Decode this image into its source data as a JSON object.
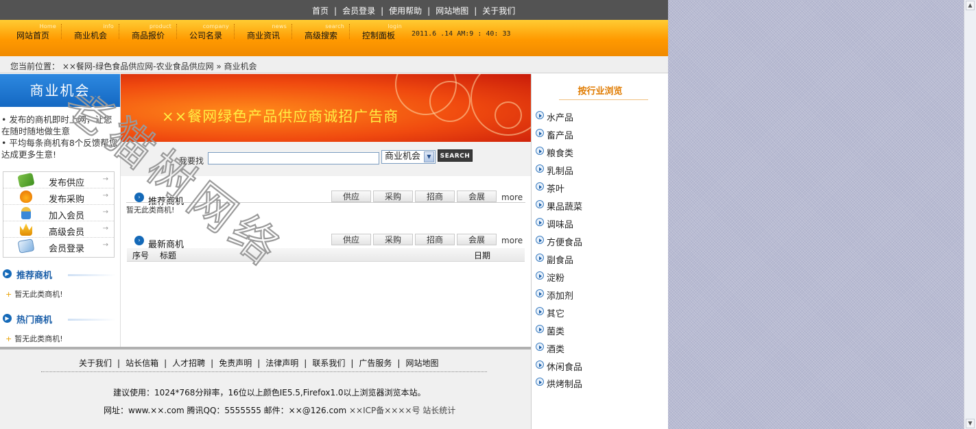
{
  "topbar": {
    "links": [
      "首页",
      "会员登录",
      "使用帮助",
      "网站地图",
      "关于我们"
    ],
    "separator": "|"
  },
  "nav": {
    "items": [
      {
        "cn": "网站首页",
        "en": "Home"
      },
      {
        "cn": "商业机会",
        "en": "info"
      },
      {
        "cn": "商品报价",
        "en": "product"
      },
      {
        "cn": "公司名录",
        "en": "company"
      },
      {
        "cn": "商业资讯",
        "en": "news"
      },
      {
        "cn": "高级搜索",
        "en": "search"
      },
      {
        "cn": "控制面板",
        "en": "login"
      }
    ],
    "clock": "2011.6 .14  AM:9  : 40: 33"
  },
  "breadcrumb": {
    "text": "您当前位置： ××餐网-绿色食品供应网-农业食品供应网 » 商业机会"
  },
  "left": {
    "header": "商业机会",
    "tips": [
      "• 发布的商机即时上网，让您在随时随地做生意",
      "• 平均每条商机有8个反馈帮您达成更多生意!"
    ],
    "menu": [
      {
        "label": "发布供应",
        "icon": "money-icon",
        "arrow": "→"
      },
      {
        "label": "发布采购",
        "icon": "bag-icon",
        "arrow": "→"
      },
      {
        "label": "加入会员",
        "icon": "person-icon",
        "arrow": "→"
      },
      {
        "label": "高级会员",
        "icon": "crown-icon",
        "arrow": "→"
      },
      {
        "label": "会员登录",
        "icon": "login-icon",
        "arrow": "→"
      }
    ],
    "recommended": {
      "title": "推荐商机",
      "empty": "暂无此类商机!"
    },
    "hot": {
      "title": "热门商机",
      "empty": "暂无此类商机!"
    },
    "bullet": "+"
  },
  "banner": {
    "text": "××餐网绿色产品供应商诚招广告商"
  },
  "search": {
    "label": "我要找",
    "value": "",
    "select": "商业机会",
    "button": "SEARCH",
    "dropdown_glyph": "▼"
  },
  "blocks": {
    "recommended": {
      "title": "推荐商机",
      "tabs": [
        "供应",
        "采购",
        "招商",
        "会展"
      ],
      "more": "more",
      "empty": "暂无此类商机!"
    },
    "latest": {
      "title": "最新商机",
      "tabs": [
        "供应",
        "采购",
        "招商",
        "会展"
      ],
      "more": "more",
      "columns": [
        "序号",
        "标题",
        "日期"
      ]
    }
  },
  "right": {
    "title": "按行业浏览",
    "items": [
      "水产品",
      "畜产品",
      "粮食类",
      "乳制品",
      "茶叶",
      "果品蔬菜",
      "调味品",
      "方便食品",
      "副食品",
      "淀粉",
      "添加剂",
      "其它",
      "菌类",
      "酒类",
      "休闲食品",
      "烘烤制品"
    ]
  },
  "footer": {
    "links": [
      "关于我们",
      "站长信箱",
      "人才招聘",
      "免责声明",
      "法律声明",
      "联系我们",
      "广告服务",
      "网站地图"
    ],
    "separator": "|",
    "recommend": "建议使用：1024*768分辩率，16位以上颜色IE5.5,Firefox1.0以上浏览器浏览本站。",
    "contact": "网址：www.××.com 腾讯QQ：5555555 邮件：××@126.com",
    "icp": "××ICP备××××号 站长统计"
  },
  "watermark": {
    "text": "老猫树网络"
  },
  "scrollbar": {
    "up": "▲",
    "down": "▼"
  },
  "colors": {
    "topbar": "#535353",
    "nav_orange": "#ff9900",
    "left_header_blue": "#1468c2",
    "right_title_orange": "#e07b00",
    "banner_red": "#f04a0f",
    "banner_text": "#ffee44"
  }
}
